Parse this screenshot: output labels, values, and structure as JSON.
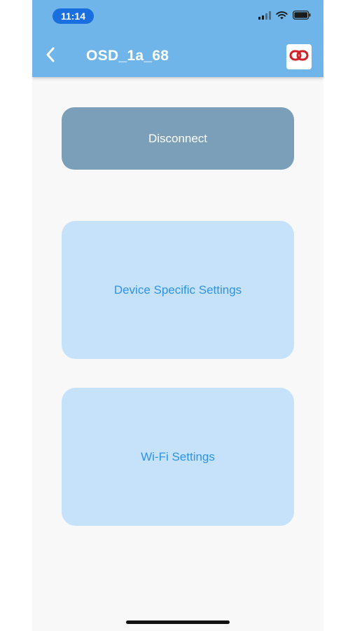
{
  "status_bar": {
    "time": "11:14",
    "icons": [
      "cellular-signal-icon",
      "wifi-icon",
      "battery-icon"
    ]
  },
  "header": {
    "back_icon": "chevron-left-icon",
    "title": "OSD_1a_68",
    "link_icon": "link-chain-icon"
  },
  "actions": {
    "disconnect_label": "Disconnect",
    "device_settings_label": "Device Specific Settings",
    "wifi_settings_label": "Wi-Fi Settings"
  },
  "colors": {
    "header_bg": "#6fb5ea",
    "time_pill": "#1a6fe0",
    "disconnect_bg": "#7b9fb8",
    "card_bg": "#c6e2fa",
    "card_text": "#2f93e6",
    "link_icon_red": "#d0202a"
  }
}
